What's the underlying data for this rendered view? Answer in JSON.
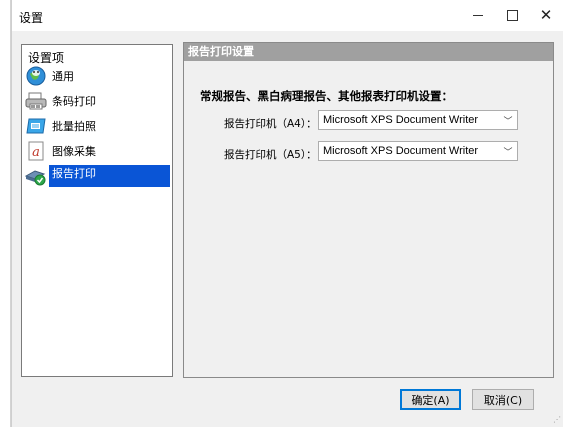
{
  "window": {
    "title": "设置",
    "minimize_icon": "minimize-icon",
    "maximize_icon": "maximize-icon",
    "close_icon": "close-icon"
  },
  "sidebar": {
    "header": "设置项",
    "items": [
      {
        "label": "通用",
        "icon": "globe-icon",
        "selected": false
      },
      {
        "label": "条码打印",
        "icon": "barcode-printer-icon",
        "selected": false
      },
      {
        "label": "批量拍照",
        "icon": "batch-photo-icon",
        "selected": false
      },
      {
        "label": "图像采集",
        "icon": "image-capture-icon",
        "selected": false
      },
      {
        "label": "报告打印",
        "icon": "report-printer-icon",
        "selected": true
      }
    ]
  },
  "content": {
    "header": "报告打印设置",
    "section_title": "常规报告、黑白病理报告、其他报表打印机设置：",
    "printers": [
      {
        "label": "报告打印机（A4）：",
        "value": "Microsoft XPS Document Writer"
      },
      {
        "label": "报告打印机（A5）：",
        "value": "Microsoft XPS Document Writer"
      }
    ]
  },
  "buttons": {
    "ok_label": "确定(A)",
    "cancel_label": "取消(C)"
  },
  "colors": {
    "selection": "#0a55d6",
    "header_bg": "#a0a0a0",
    "focus_border": "#0078d7"
  }
}
